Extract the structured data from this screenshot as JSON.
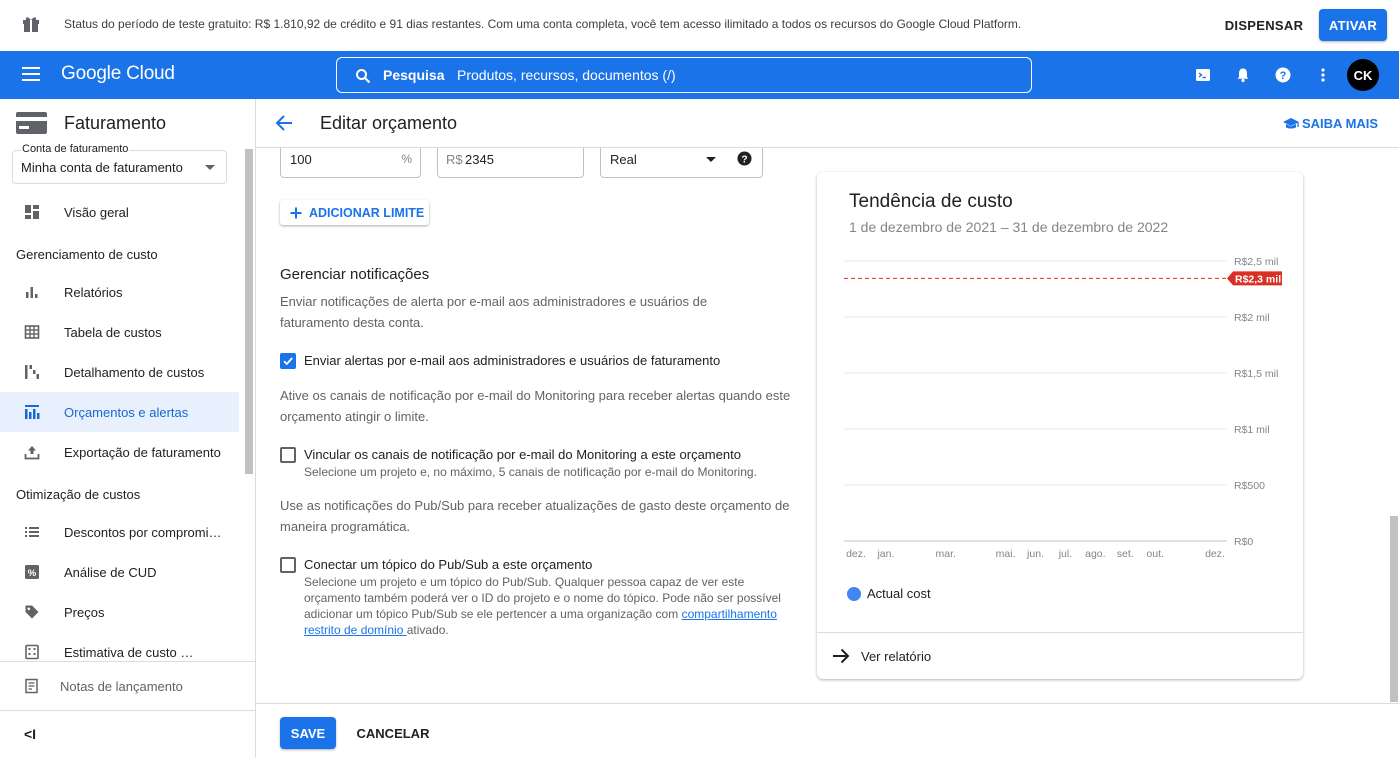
{
  "trial_banner": {
    "message": "Status do período de teste gratuito: R$ 1.810,92 de crédito e 91 dias restantes. Com uma conta completa, você tem acesso ilimitado a todos os recursos do Google Cloud Platform.",
    "dismiss_label": "DISPENSAR",
    "activate_label": "ATIVAR"
  },
  "topbar": {
    "logo": "Google Cloud",
    "search_bold": "Pesquisa",
    "search_placeholder": "Produtos, recursos, documentos (/)",
    "avatar_initials": "CK",
    "icons": [
      "cloud-shell-icon",
      "notifications-icon",
      "help-icon",
      "more-vert-icon"
    ]
  },
  "sidebar": {
    "title": "Faturamento",
    "account_label": "Conta de faturamento",
    "account_value": "Minha conta de faturamento",
    "items": [
      {
        "label": "Visão geral",
        "icon": "dashboard-icon"
      },
      {
        "section": "Gerenciamento de custo"
      },
      {
        "label": "Relatórios",
        "icon": "bar-chart-icon"
      },
      {
        "label": "Tabela de custos",
        "icon": "table-icon"
      },
      {
        "label": "Detalhamento de custos",
        "icon": "breakdown-icon"
      },
      {
        "label": "Orçamentos e alertas",
        "icon": "budget-icon",
        "selected": true
      },
      {
        "label": "Exportação de faturamento",
        "icon": "upload-icon"
      },
      {
        "section": "Otimização de custos"
      },
      {
        "label": "Descontos por compromi…",
        "icon": "list-icon"
      },
      {
        "label": "Análise de CUD",
        "icon": "percent-icon"
      },
      {
        "label": "Preços",
        "icon": "tag-icon"
      },
      {
        "label": "Estimativa de custo …",
        "icon": "calculator-icon"
      }
    ],
    "release_notes": "Notas de lançamento",
    "collapse": "<I"
  },
  "page": {
    "title": "Editar orçamento",
    "learn_more": "SAIBA MAIS"
  },
  "threshold": {
    "percent_value": "100",
    "percent_suffix": "%",
    "amount_prefix": "R$",
    "amount_value": "2345",
    "trigger_value": "Real",
    "add_limit": "ADICIONAR LIMITE"
  },
  "notifications": {
    "heading": "Gerenciar notificações",
    "intro": "Enviar notificações de alerta por e-mail aos administradores e usuários de faturamento desta conta.",
    "email_admins": {
      "label": "Enviar alertas por e-mail aos administradores e usuários de faturamento",
      "checked": true
    },
    "monitoring_intro": "Ative os canais de notificação por e-mail do Monitoring para receber alertas quando este orçamento atingir o limite.",
    "monitoring": {
      "label": "Vincular os canais de notificação por e-mail do Monitoring a este orçamento",
      "sub": "Selecione um projeto e, no máximo, 5 canais de notificação por e-mail do Monitoring.",
      "checked": false
    },
    "pubsub_intro": "Use as notificações do Pub/Sub para receber atualizações de gasto deste orçamento de maneira programática.",
    "pubsub": {
      "label": "Conectar um tópico do Pub/Sub a este orçamento",
      "sub_before": "Selecione um projeto e um tópico do Pub/Sub. Qualquer pessoa capaz de ver este orçamento também poderá ver o ID do projeto e o nome do tópico. Pode não ser possível adicionar um tópico Pub/Sub se ele pertencer a uma organização com ",
      "sub_link": "compartilhamento restrito de domínio ",
      "sub_after": "ativado.",
      "checked": false
    }
  },
  "trend_card": {
    "title": "Tendência de custo",
    "date_range": "1 de dezembro de 2021 – 31 de dezembro de 2022",
    "legend": "Actual cost",
    "view_report": "Ver relatório"
  },
  "chart_data": {
    "type": "line",
    "title": "Tendência de custo",
    "x": [
      "dez.",
      "jan.",
      "mar.",
      "mai.",
      "jun.",
      "jul.",
      "ago.",
      "set.",
      "out.",
      "dez."
    ],
    "y_ticks": [
      "R$0",
      "R$500",
      "R$1 mil",
      "R$1,5 mil",
      "R$2 mil",
      "R$2,5 mil"
    ],
    "ylim": [
      0,
      2500
    ],
    "budget_line": {
      "label": "R$2,3 mil",
      "value": 2345,
      "color": "#d93025"
    },
    "series": [
      {
        "name": "Actual cost",
        "color": "#4285f4",
        "values": [
          0,
          0,
          0,
          0,
          0,
          0,
          0,
          0,
          0,
          0
        ]
      }
    ],
    "legend": "bottom-left",
    "grid": true
  },
  "footer": {
    "save": "SAVE",
    "cancel": "CANCELAR"
  },
  "colors": {
    "primary": "#1a73e8",
    "selected_bg": "#e8f0fe",
    "budget_red": "#d93025"
  }
}
